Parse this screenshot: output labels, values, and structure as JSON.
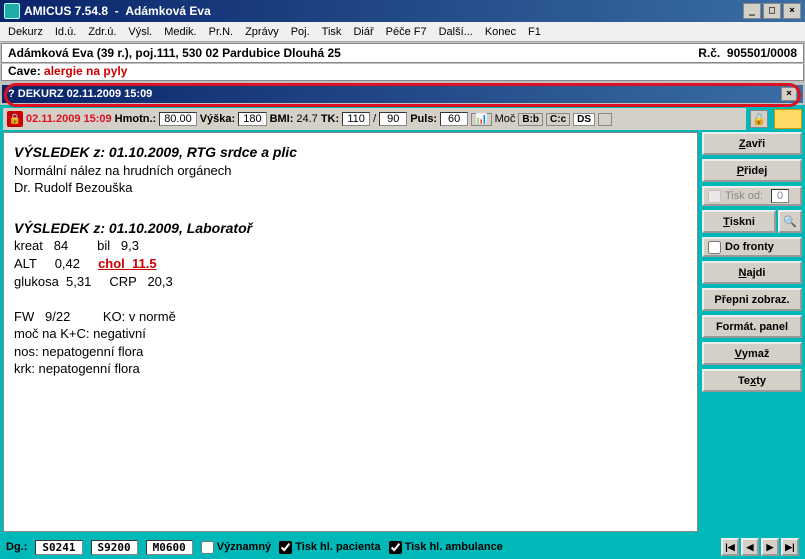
{
  "window": {
    "app_name": "AMICUS  7.54.8",
    "patient_name": "Adámková Eva"
  },
  "menu": [
    "Dekurz",
    "Id.ú.",
    "Zdr.ú.",
    "Výsl.",
    "Medik.",
    "Pr.N.",
    "Zprávy",
    "Poj.",
    "Tisk",
    "Diář",
    "Péče F7",
    "Další...",
    "Konec",
    "F1"
  ],
  "patient": {
    "line": "Adámková Eva (39 r.), poj.111,   530 02 Pardubice  Dlouhá 25",
    "rc_label": "R.č.",
    "rc": "905501/0008",
    "cave_label": "Cave:",
    "cave_text": "alergie na pyly"
  },
  "subwindow": {
    "title": "? DEKURZ 02.11.2009 15:09"
  },
  "vitals": {
    "date": "02.11.2009 15:09",
    "hmotn_lbl": "Hmotn.:",
    "hmotn": "80.00",
    "vyska_lbl": "Výška:",
    "vyska": "180",
    "bmi_lbl": "BMI:",
    "bmi": "24.7",
    "tk_lbl": "TK:",
    "tk_s": "110",
    "tk_d": "90",
    "puls_lbl": "Puls:",
    "puls": "60",
    "moc": "Moč",
    "dgs": "DS"
  },
  "editor": {
    "h1": "VÝSLEDEK z: 01.10.2009, RTG srdce a plic",
    "l1": "Normální  nález na hrudních orgánech",
    "l2": "Dr. Rudolf Bezouška",
    "h2": "VÝSLEDEK z: 01.10.2009, Laboratoř",
    "r1a": "kreat   84        bil   9,3",
    "r2a": "ALT     0,42     ",
    "chol": "chol  11.5",
    "r3": "glukosa  5,31     CRP   20,3",
    "r4": "FW   9/22         KO: v normě",
    "r5": "moč na K+C: negativní",
    "r6": "nos: nepatogenní flora",
    "r7": "krk: nepatogenní flora"
  },
  "buttons": {
    "zavri": "Zavři",
    "pridej": "Přidej",
    "tiskod": "Tisk od:",
    "tiskod_val": "0",
    "tiskni": "Tiskni",
    "dofronty": "Do fronty",
    "najdi": "Najdi",
    "prepni": "Přepni zobraz.",
    "format": "Formát. panel",
    "vymaz": "Vymaž",
    "texty": "Texty"
  },
  "footer": {
    "dg_lbl": "Dg.:",
    "dg1": "S0241",
    "dg2": "S9200",
    "dg3": "M0600",
    "vyznamny": "Významný",
    "tisk_pac": "Tisk hl. pacienta",
    "tisk_amb": "Tisk hl. ambulance"
  }
}
